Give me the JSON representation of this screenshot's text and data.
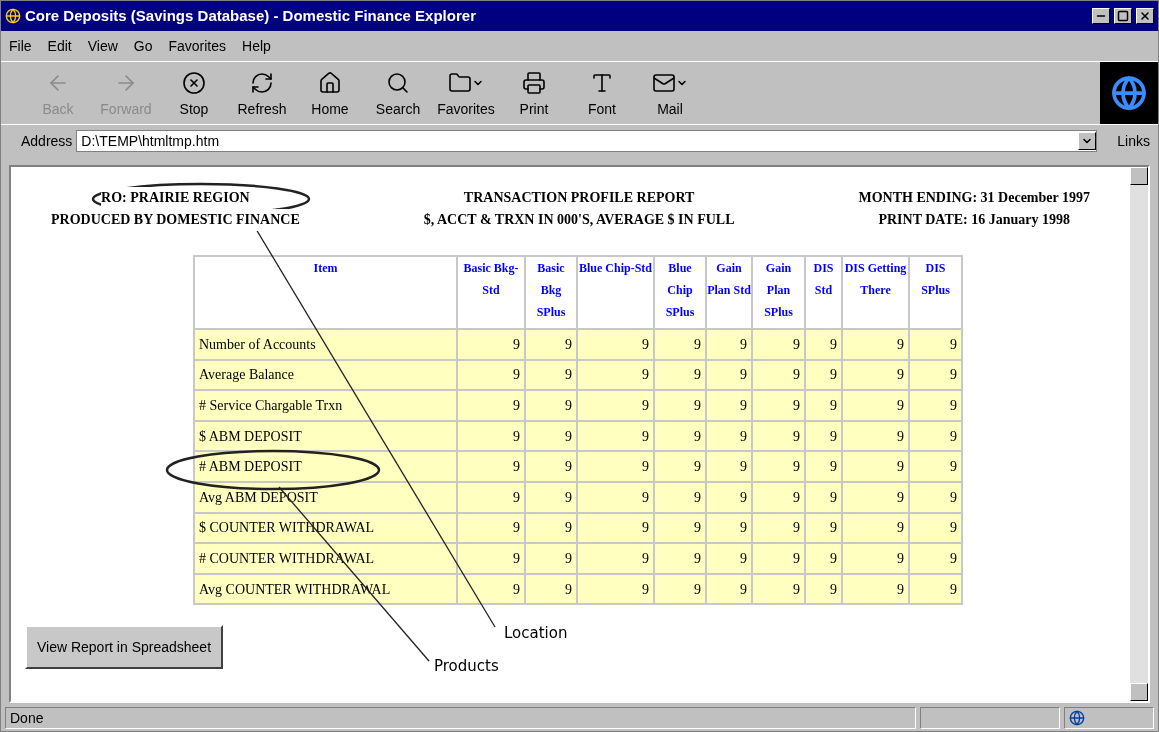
{
  "window": {
    "title": "Core Deposits (Savings Database) - Domestic Finance Explorer"
  },
  "menu": [
    "File",
    "Edit",
    "View",
    "Go",
    "Favorites",
    "Help"
  ],
  "toolbar": [
    {
      "label": "Back",
      "kind": "back",
      "disabled": true,
      "dropdown": false
    },
    {
      "label": "Forward",
      "kind": "forward",
      "disabled": true,
      "dropdown": false
    },
    {
      "label": "Stop",
      "kind": "stop",
      "disabled": false,
      "dropdown": false
    },
    {
      "label": "Refresh",
      "kind": "refresh",
      "disabled": false,
      "dropdown": false
    },
    {
      "label": "Home",
      "kind": "home",
      "disabled": false,
      "dropdown": false
    },
    {
      "label": "Search",
      "kind": "search",
      "disabled": false,
      "dropdown": false
    },
    {
      "label": "Favorites",
      "kind": "favorites",
      "disabled": false,
      "dropdown": true
    },
    {
      "label": "Print",
      "kind": "print",
      "disabled": false,
      "dropdown": false
    },
    {
      "label": "Font",
      "kind": "font",
      "disabled": false,
      "dropdown": false
    },
    {
      "label": "Mail",
      "kind": "mail",
      "disabled": false,
      "dropdown": true
    }
  ],
  "address": {
    "label": "Address",
    "value": "D:\\TEMP\\htmltmp.htm",
    "links": "Links"
  },
  "report": {
    "header_left": [
      "RO: PRAIRIE REGION",
      "PRODUCED BY  DOMESTIC FINANCE"
    ],
    "header_center": [
      "TRANSACTION PROFILE REPORT",
      "$, ACCT & TRXN IN 000'S, AVERAGE $ IN FULL"
    ],
    "header_right": [
      "MONTH ENDING: 31 December 1997",
      "PRINT DATE: 16 January 1998"
    ],
    "table": {
      "columns": [
        "Item",
        "Basic Bkg-Std",
        "Basic Bkg SPlus",
        "Blue Chip-Std",
        "Blue Chip SPlus",
        "Gain Plan Std",
        "Gain Plan SPlus",
        "DIS Std",
        "DIS Getting There",
        "DIS SPlus"
      ],
      "rows": [
        [
          "Number of Accounts",
          "9",
          "9",
          "9",
          "9",
          "9",
          "9",
          "9",
          "9",
          "9"
        ],
        [
          "Average Balance",
          "9",
          "9",
          "9",
          "9",
          "9",
          "9",
          "9",
          "9",
          "9"
        ],
        [
          "# Service Chargable Trxn",
          "9",
          "9",
          "9",
          "9",
          "9",
          "9",
          "9",
          "9",
          "9"
        ],
        [
          "$ ABM DEPOSIT",
          "9",
          "9",
          "9",
          "9",
          "9",
          "9",
          "9",
          "9",
          "9"
        ],
        [
          "# ABM DEPOSIT",
          "9",
          "9",
          "9",
          "9",
          "9",
          "9",
          "9",
          "9",
          "9"
        ],
        [
          "Avg ABM DEPOSIT",
          "9",
          "9",
          "9",
          "9",
          "9",
          "9",
          "9",
          "9",
          "9"
        ],
        [
          "$ COUNTER WITHDRAWAL",
          "9",
          "9",
          "9",
          "9",
          "9",
          "9",
          "9",
          "9",
          "9"
        ],
        [
          "# COUNTER WITHDRAWAL",
          "9",
          "9",
          "9",
          "9",
          "9",
          "9",
          "9",
          "9",
          "9"
        ],
        [
          "Avg COUNTER WITHDRAWAL",
          "9",
          "9",
          "9",
          "9",
          "9",
          "9",
          "9",
          "9",
          "9"
        ]
      ]
    },
    "button": "View Report in Spreadsheet"
  },
  "annotations": [
    "Location",
    "Products"
  ],
  "status_bar": {
    "text": "Done"
  }
}
